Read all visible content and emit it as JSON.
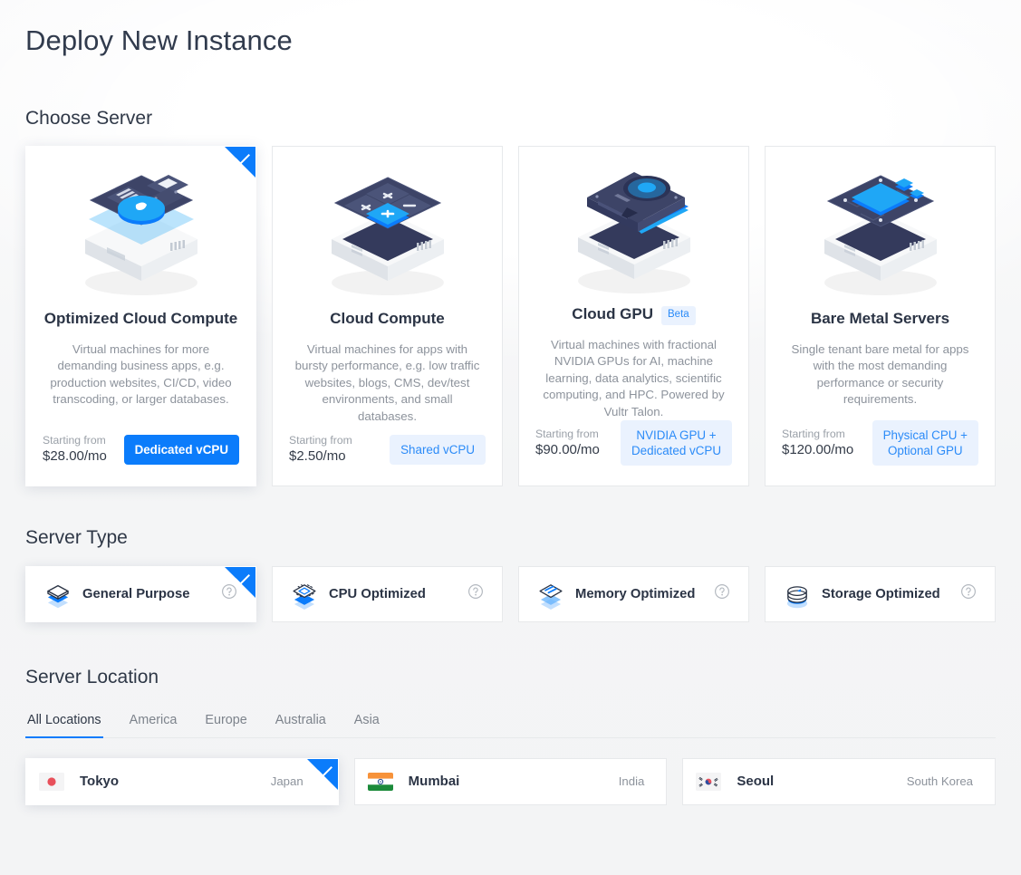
{
  "page": {
    "title": "Deploy New Instance"
  },
  "choose_server": {
    "title": "Choose Server",
    "price_label": "Starting from",
    "cards": [
      {
        "name": "Optimized Cloud Compute",
        "badge": "",
        "description": "Virtual machines for more demanding business apps, e.g. production websites, CI/CD, video transcoding, or larger databases.",
        "price": "$28.00/mo",
        "cpu_label": "Dedicated vCPU",
        "cpu_style": "primary",
        "selected": true,
        "art": "optimized-cloud-compute-art"
      },
      {
        "name": "Cloud Compute",
        "badge": "",
        "description": "Virtual machines for apps with bursty performance, e.g. low traffic websites, blogs, CMS, dev/test environments, and small databases.",
        "price": "$2.50/mo",
        "cpu_label": "Shared vCPU",
        "cpu_style": "soft",
        "selected": false,
        "art": "cloud-compute-art"
      },
      {
        "name": "Cloud GPU",
        "badge": "Beta",
        "description": "Virtual machines with fractional NVIDIA GPUs for AI, machine learning, data analytics, scientific computing, and HPC. Powered by Vultr Talon.",
        "price": "$90.00/mo",
        "cpu_label": "NVIDIA GPU +\nDedicated vCPU",
        "cpu_style": "soft",
        "selected": false,
        "art": "cloud-gpu-art"
      },
      {
        "name": "Bare Metal Servers",
        "badge": "",
        "description": "Single tenant bare metal for apps with the most demanding performance or security requirements.",
        "price": "$120.00/mo",
        "cpu_label": "Physical CPU +\nOptional GPU",
        "cpu_style": "soft",
        "selected": false,
        "art": "bare-metal-art"
      }
    ]
  },
  "server_type": {
    "title": "Server Type",
    "options": [
      {
        "label": "General Purpose",
        "icon": "stacked-layers-icon",
        "selected": true,
        "help": "help-icon"
      },
      {
        "label": "CPU Optimized",
        "icon": "cpu-chip-layers-icon",
        "selected": false,
        "help": "help-icon"
      },
      {
        "label": "Memory Optimized",
        "icon": "memory-layers-icon",
        "selected": false,
        "help": "help-icon"
      },
      {
        "label": "Storage Optimized",
        "icon": "storage-disk-icon",
        "selected": false,
        "help": "help-icon"
      }
    ]
  },
  "server_location": {
    "title": "Server Location",
    "tabs": [
      {
        "label": "All Locations",
        "active": true
      },
      {
        "label": "America",
        "active": false
      },
      {
        "label": "Europe",
        "active": false
      },
      {
        "label": "Australia",
        "active": false
      },
      {
        "label": "Asia",
        "active": false
      }
    ],
    "locations": [
      {
        "city": "Tokyo",
        "country": "Japan",
        "flag": "flag-japan",
        "selected": true
      },
      {
        "city": "Mumbai",
        "country": "India",
        "flag": "flag-india",
        "selected": false
      },
      {
        "city": "Seoul",
        "country": "South Korea",
        "flag": "flag-south-korea",
        "selected": false
      }
    ]
  },
  "colors": {
    "accent": "#0b7cfb",
    "accent_soft_bg": "#eaf2fe",
    "accent_soft_text": "#2b8bf8",
    "page_bg": "#f4f5f6",
    "card_bg": "#ffffff",
    "border": "#e7e9eb",
    "text_primary": "#2b3445",
    "text_muted": "#8d939c"
  }
}
